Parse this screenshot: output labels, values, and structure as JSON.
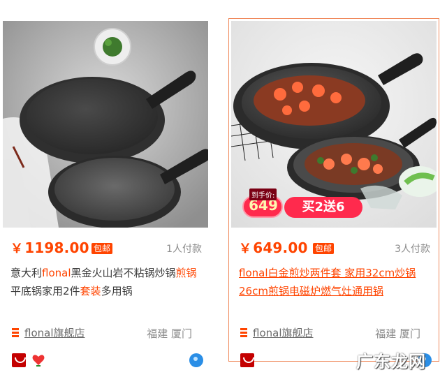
{
  "products": [
    {
      "currency": "￥",
      "price": "1198.00",
      "badge": "包邮",
      "sold": "1人付款",
      "title_parts": [
        "意大利",
        "flonal",
        "黑金火山岩不粘锅炒锅",
        "煎锅",
        "平底锅家用2件",
        "套装",
        "多用锅"
      ],
      "shop_name": "flonal旗舰店",
      "location": "福建 厦门"
    },
    {
      "currency": "￥",
      "price": "649.00",
      "badge": "包邮",
      "sold": "3人付款",
      "title": "flonal白金煎炒两件套 家用32cm炒锅26cm煎锅电磁炉燃气灶通用锅",
      "shop_name": "flonal旗舰店",
      "location": "福建 厦门",
      "promo": {
        "top": "到手价:",
        "price": "649",
        "deal": "买2送6"
      }
    }
  ],
  "watermark": "广东龙网",
  "colors": {
    "accent": "#ff4400",
    "border": "#f08a5d"
  },
  "icons": [
    "tmall-icon",
    "heart-icon",
    "wangwang-icon",
    "shop-icon"
  ]
}
